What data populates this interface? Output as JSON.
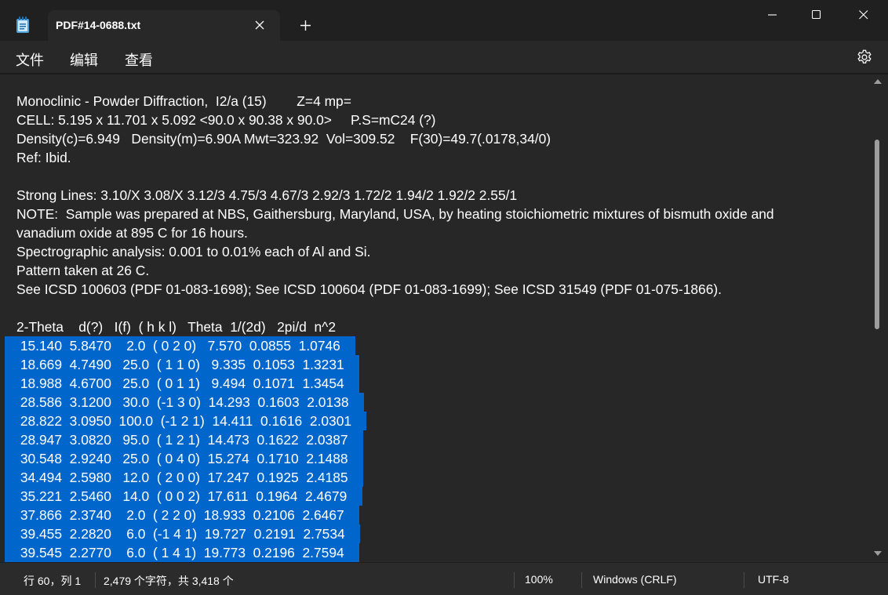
{
  "window": {
    "tab_title": "PDF#14-0688.txt",
    "icons": [
      "notepad-icon",
      "close-icon",
      "plus-icon",
      "minimize-icon",
      "maximize-icon",
      "close-icon",
      "gear-icon"
    ]
  },
  "menu": {
    "file": "文件",
    "edit": "编辑",
    "view": "查看"
  },
  "editor": {
    "lines": [
      "Monoclinic - Powder Diffraction,  I2/a (15)        Z=4 mp=",
      "CELL: 5.195 x 11.701 x 5.092 <90.0 x 90.38 x 90.0>     P.S=mC24 (?)",
      "Density(c)=6.949   Density(m)=6.90A Mwt=323.92  Vol=309.52    F(30)=49.7(.0178,34/0)",
      "Ref: Ibid.",
      "",
      "Strong Lines: 3.10/X 3.08/X 3.12/3 4.75/3 4.67/3 2.92/3 1.72/2 1.94/2 1.92/2 2.55/1",
      "NOTE:  Sample was prepared at NBS, Gaithersburg, Maryland, USA, by heating stoichiometric mixtures of bismuth oxide and",
      "vanadium oxide at 895 C for 16 hours.",
      "Spectrographic analysis: 0.001 to 0.01% each of Al and Si.",
      "Pattern taken at 26 C.",
      "See ICSD 100603 (PDF 01-083-1698); See ICSD 100604 (PDF 01-083-1699); See ICSD 31549 (PDF 01-075-1866).",
      "",
      "2-Theta    d(?)   I(f)  ( h k l)   Theta  1/(2d)   2pi/d  n^2"
    ],
    "selected_lines": [
      " 15.140  5.8470    2.0  ( 0 2 0)   7.570  0.0855  1.0746    ",
      " 18.669  4.7490   25.0  ( 1 1 0)   9.335  0.1053  1.3231    ",
      " 18.988  4.6700   25.0  ( 0 1 1)   9.494  0.1071  1.3454    ",
      " 28.586  3.1200   30.0  (-1 3 0)  14.293  0.1603  2.0138    ",
      " 28.822  3.0950  100.0  (-1 2 1)  14.411  0.1616  2.0301    ",
      " 28.947  3.0820   95.0  ( 1 2 1)  14.473  0.1622  2.0387    ",
      " 30.548  2.9240   25.0  ( 0 4 0)  15.274  0.1710  2.1488    ",
      " 34.494  2.5980   12.0  ( 2 0 0)  17.247  0.1925  2.4185    ",
      " 35.221  2.5460   14.0  ( 0 0 2)  17.611  0.1964  2.4679    ",
      " 37.866  2.3740    2.0  ( 2 2 0)  18.933  0.2106  2.6467    ",
      " 39.455  2.2820    6.0  (-1 4 1)  19.727  0.2191  2.7534    ",
      " 39.545  2.2770    6.0  ( 1 4 1)  19.773  0.2196  2.7594    "
    ],
    "selection_color": "#0066cc"
  },
  "status": {
    "position": "行 60，列 1",
    "char_count": "2,479 个字符，共 3,418 个",
    "zoom": "100%",
    "line_ending": "Windows (CRLF)",
    "encoding": "UTF-8"
  }
}
